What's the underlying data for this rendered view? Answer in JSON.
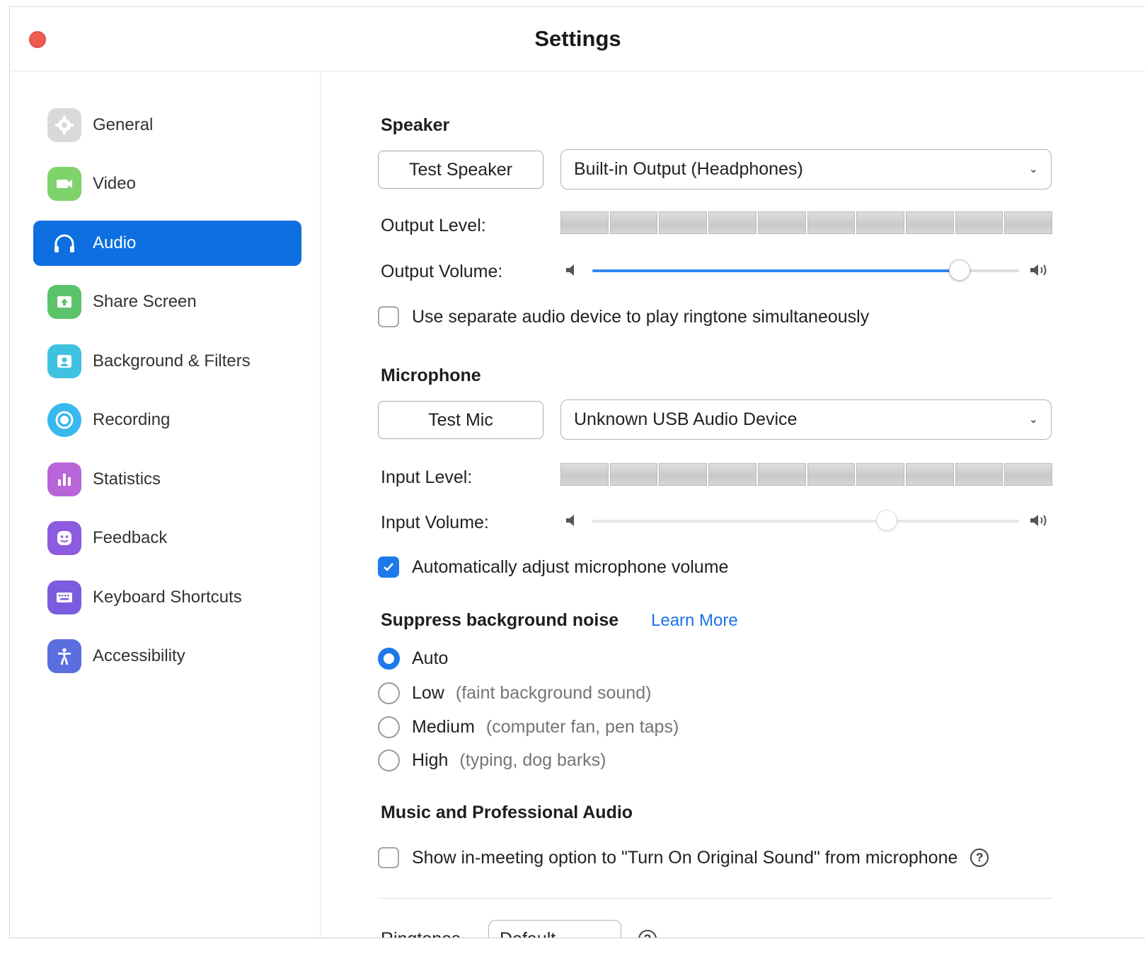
{
  "window": {
    "title": "Settings"
  },
  "sidebar": {
    "items": [
      {
        "label": "General",
        "icon": "gear-icon",
        "color": "#d4d4d4",
        "active": false
      },
      {
        "label": "Video",
        "icon": "video-camera-icon",
        "color": "#7fd36b",
        "active": false
      },
      {
        "label": "Audio",
        "icon": "headphones-icon",
        "color": "#0e6fe0",
        "active": true
      },
      {
        "label": "Share Screen",
        "icon": "share-screen-icon",
        "color": "#5bc46a",
        "active": false
      },
      {
        "label": "Background & Filters",
        "icon": "background-icon",
        "color": "#3fc2e0",
        "active": false
      },
      {
        "label": "Recording",
        "icon": "recording-icon",
        "color": "#38b8ef",
        "active": false
      },
      {
        "label": "Statistics",
        "icon": "statistics-icon",
        "color": "#b865d9",
        "active": false
      },
      {
        "label": "Feedback",
        "icon": "feedback-icon",
        "color": "#8d5ae0",
        "active": false
      },
      {
        "label": "Keyboard Shortcuts",
        "icon": "keyboard-icon",
        "color": "#7c5cde",
        "active": false
      },
      {
        "label": "Accessibility",
        "icon": "accessibility-icon",
        "color": "#5b6ee0",
        "active": false
      }
    ]
  },
  "speaker": {
    "heading": "Speaker",
    "test_button": "Test Speaker",
    "device": "Built-in Output (Headphones)",
    "output_level_label": "Output Level:",
    "output_volume_label": "Output Volume:",
    "output_volume": 0.86,
    "separate_device_label": "Use separate audio device to play ringtone simultaneously",
    "separate_device_checked": false
  },
  "microphone": {
    "heading": "Microphone",
    "test_button": "Test Mic",
    "device": "Unknown USB Audio Device",
    "input_level_label": "Input Level:",
    "input_volume_label": "Input Volume:",
    "input_volume": 0.69,
    "auto_adjust_label": "Automatically adjust microphone volume",
    "auto_adjust_checked": true
  },
  "noise": {
    "heading": "Suppress background noise",
    "learn_more": "Learn More",
    "options": [
      {
        "label": "Auto",
        "hint": "",
        "selected": true
      },
      {
        "label": "Low",
        "hint": "(faint background sound)",
        "selected": false
      },
      {
        "label": "Medium",
        "hint": "(computer fan, pen taps)",
        "selected": false
      },
      {
        "label": "High",
        "hint": "(typing, dog barks)",
        "selected": false
      }
    ]
  },
  "music": {
    "heading": "Music and Professional Audio",
    "original_sound_label": "Show in-meeting option to \"Turn On Original Sound\" from microphone",
    "original_sound_checked": false
  },
  "ringtones": {
    "label": "Ringtones",
    "value": "Default"
  },
  "colors": {
    "accent": "#1d79ea",
    "active_nav": "#0e6fe0",
    "close": "#ee5b51",
    "link": "#1a73e8"
  }
}
